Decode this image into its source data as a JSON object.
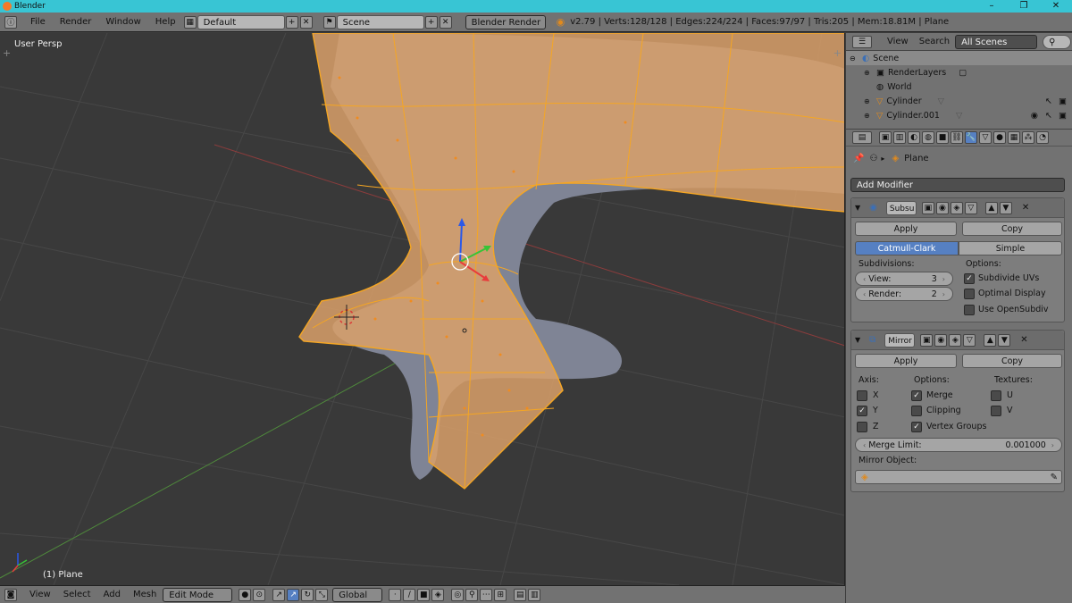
{
  "window": {
    "title": "Blender",
    "controls": [
      "–",
      "❐",
      "✕"
    ]
  },
  "topbar": {
    "menus": [
      "File",
      "Render",
      "Window",
      "Help"
    ],
    "layout": "Default",
    "scene": "Scene",
    "engine": "Blender Render",
    "stats": "v2.79 | Verts:128/128 | Edges:224/224 | Faces:97/97 | Tris:205 | Mem:18.81M | Plane"
  },
  "viewport": {
    "view_label": "User Persp",
    "object_label": "(1) Plane"
  },
  "bottombar": {
    "menus": [
      "View",
      "Select",
      "Add",
      "Mesh"
    ],
    "mode": "Edit Mode",
    "orientation": "Global"
  },
  "outliner": {
    "menus": [
      "View",
      "Search"
    ],
    "filter": "All Scenes",
    "items": [
      {
        "label": "Scene",
        "icon": "scene-icon"
      },
      {
        "label": "RenderLayers",
        "icon": "renderlayers-icon"
      },
      {
        "label": "World",
        "icon": "world-icon"
      },
      {
        "label": "Cylinder",
        "icon": "mesh-icon"
      },
      {
        "label": "Cylinder.001",
        "icon": "mesh-icon"
      }
    ]
  },
  "properties": {
    "context_object": "Plane",
    "add_modifier": "Add Modifier",
    "subsurf": {
      "name": "Subsu",
      "apply": "Apply",
      "copy": "Copy",
      "algorithms": [
        "Catmull-Clark",
        "Simple"
      ],
      "subdivisions_label": "Subdivisions:",
      "view_label": "View:",
      "view_value": "3",
      "render_label": "Render:",
      "render_value": "2",
      "options_label": "Options:",
      "options": [
        {
          "label": "Subdivide UVs",
          "checked": true
        },
        {
          "label": "Optimal Display",
          "checked": false
        },
        {
          "label": "Use OpenSubdiv",
          "checked": false
        }
      ]
    },
    "mirror": {
      "name": "Mirror",
      "apply": "Apply",
      "copy": "Copy",
      "axis_label": "Axis:",
      "axis": [
        {
          "label": "X",
          "checked": false
        },
        {
          "label": "Y",
          "checked": true
        },
        {
          "label": "Z",
          "checked": false
        }
      ],
      "options_label": "Options:",
      "options": [
        {
          "label": "Merge",
          "checked": true
        },
        {
          "label": "Clipping",
          "checked": false
        },
        {
          "label": "Vertex Groups",
          "checked": true
        }
      ],
      "textures_label": "Textures:",
      "textures": [
        {
          "label": "U",
          "checked": false
        },
        {
          "label": "V",
          "checked": false
        }
      ],
      "merge_limit_label": "Merge Limit:",
      "merge_limit_value": "0.001000",
      "mirror_object_label": "Mirror Object:"
    }
  },
  "colors": {
    "accent": "#5680c2",
    "selection": "#f5a623",
    "titlebar": "#38c5d4"
  }
}
